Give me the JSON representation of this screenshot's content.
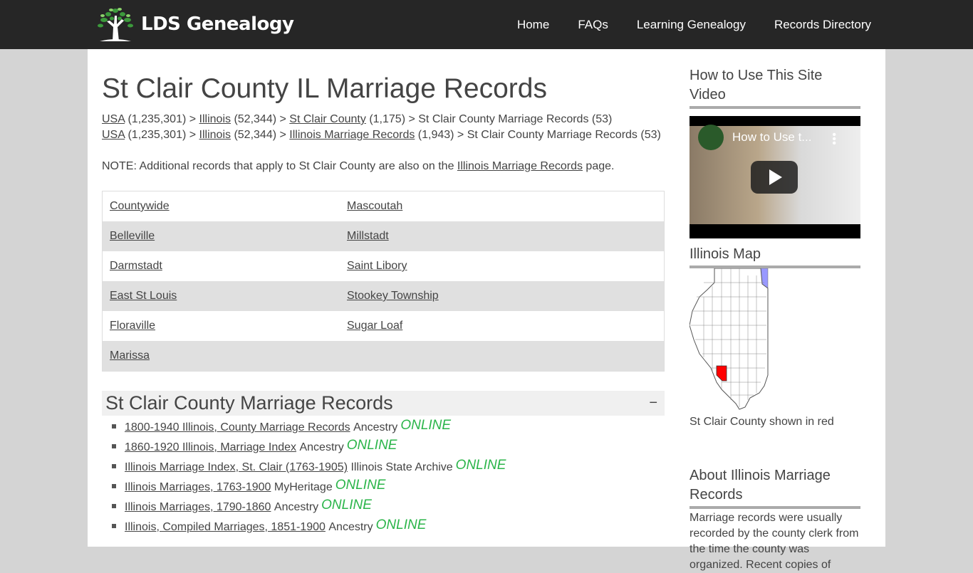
{
  "site": {
    "logo_text": "LDS Genealogy",
    "nav": [
      "Home",
      "FAQs",
      "Learning Genealogy",
      "Records Directory"
    ]
  },
  "main": {
    "title": "St Clair County IL Marriage Records",
    "breadcrumbs": [
      [
        {
          "text": "USA",
          "link": true
        },
        {
          "text": " (1,235,301) > ",
          "link": false
        },
        {
          "text": "Illinois",
          "link": true
        },
        {
          "text": " (52,344) > ",
          "link": false
        },
        {
          "text": "St Clair County",
          "link": true
        },
        {
          "text": " (1,175) > St Clair County Marriage Records (53)",
          "link": false
        }
      ],
      [
        {
          "text": "USA",
          "link": true
        },
        {
          "text": " (1,235,301) > ",
          "link": false
        },
        {
          "text": "Illinois",
          "link": true
        },
        {
          "text": " (52,344) > ",
          "link": false
        },
        {
          "text": "Illinois Marriage Records",
          "link": true
        },
        {
          "text": " (1,943) > St Clair County Marriage Records (53)",
          "link": false
        }
      ]
    ],
    "note_prefix": "NOTE: Additional records that apply to St Clair County are also on the ",
    "note_link": "Illinois Marriage Records",
    "note_suffix": " page.",
    "locations": [
      [
        "Countywide",
        "Mascoutah"
      ],
      [
        "Belleville",
        "Millstadt"
      ],
      [
        "Darmstadt",
        "Saint Libory"
      ],
      [
        "East St Louis",
        "Stookey Township"
      ],
      [
        "Floraville",
        "Sugar Loaf"
      ],
      [
        "Marissa",
        ""
      ]
    ],
    "section_title": "St Clair County Marriage Records",
    "collapse_symbol": "−",
    "online_label": "ONLINE",
    "online_color": "#2bb54a",
    "records": [
      {
        "title": "1800-1940 Illinois, County Marriage Records",
        "source": "Ancestry"
      },
      {
        "title": "1860-1920 Illinois, Marriage Index",
        "source": "Ancestry"
      },
      {
        "title": "Illinois Marriage Index, St. Clair (1763-1905)",
        "source": "Illinois State Archive"
      },
      {
        "title": "Illinois Marriages, 1763-1900",
        "source": "MyHeritage"
      },
      {
        "title": "Illinois Marriages, 1790-1860",
        "source": "Ancestry"
      },
      {
        "title": "Illinois, Compiled Marriages, 1851-1900",
        "source": "Ancestry"
      }
    ]
  },
  "sidebar": {
    "video_heading": "How to Use This Site Video",
    "video_title": "How to Use t...",
    "map_heading": "Illinois Map",
    "map_caption": "St Clair County shown in red",
    "highlight_color": "#ff0000",
    "about_heading": "About Illinois Marriage Records",
    "about_text": "Marriage records were usually recorded by the county clerk from the time the county was organized. Recent copies of"
  }
}
